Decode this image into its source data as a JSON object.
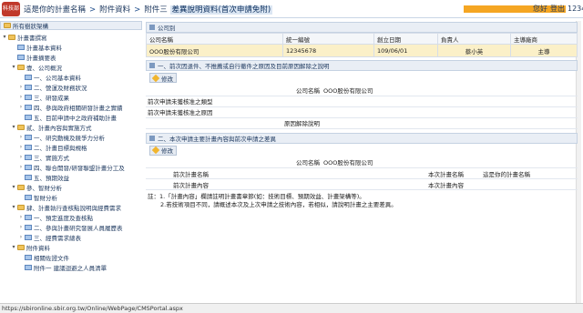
{
  "header": {
    "logo_text": "科技部",
    "breadcrumb": [
      "這是你的計畫名稱",
      "附件資料",
      "附件三"
    ],
    "current_page": "差異說明資料(首次申請免附)",
    "links": [
      "您好",
      "登出",
      "12345"
    ]
  },
  "sidebar": {
    "title": "所有樹狀架構",
    "items": [
      {
        "label": "計畫書撰寫",
        "level": 1,
        "toggle": "▾",
        "icon": "folder"
      },
      {
        "label": "計畫基本資料",
        "level": 2,
        "toggle": "",
        "icon": "doc"
      },
      {
        "label": "計畫摘要表",
        "level": 2,
        "toggle": "",
        "icon": "doc"
      },
      {
        "label": "壹、公司概況",
        "level": 2,
        "toggle": "▾",
        "icon": "folder"
      },
      {
        "label": "一、公司基本資料",
        "level": 3,
        "toggle": "",
        "icon": "doc"
      },
      {
        "label": "二、營運及財務狀況",
        "level": 3,
        "toggle": "›",
        "icon": "doc"
      },
      {
        "label": "三、研發成果",
        "level": 3,
        "toggle": "›",
        "icon": "doc"
      },
      {
        "label": "四、參與政府相關研發計畫之實績",
        "level": 3,
        "toggle": "›",
        "icon": "doc"
      },
      {
        "label": "五、目前申請中之政府補助計畫",
        "level": 3,
        "toggle": "",
        "icon": "doc"
      },
      {
        "label": "貳、計畫內容與實施方式",
        "level": 2,
        "toggle": "▾",
        "icon": "folder"
      },
      {
        "label": "一、研究動機及競爭力分析",
        "level": 3,
        "toggle": "›",
        "icon": "doc"
      },
      {
        "label": "二、計畫目標與規格",
        "level": 3,
        "toggle": "›",
        "icon": "doc"
      },
      {
        "label": "三、實施方式",
        "level": 3,
        "toggle": "›",
        "icon": "doc"
      },
      {
        "label": "四、聯合開發/研發聯盟計畫分工及",
        "level": 3,
        "toggle": "›",
        "icon": "doc"
      },
      {
        "label": "五、預期效益",
        "level": 3,
        "toggle": "",
        "icon": "doc"
      },
      {
        "label": "參、智財分析",
        "level": 2,
        "toggle": "▾",
        "icon": "folder"
      },
      {
        "label": "智財分析",
        "level": 3,
        "toggle": "",
        "icon": "doc"
      },
      {
        "label": "肆、計畫執行查核點說明與經費需求",
        "level": 2,
        "toggle": "▾",
        "icon": "folder"
      },
      {
        "label": "一、預定進度及查核點",
        "level": 3,
        "toggle": "›",
        "icon": "doc"
      },
      {
        "label": "二、參與計畫研究發展人員履歷表",
        "level": 3,
        "toggle": "›",
        "icon": "doc"
      },
      {
        "label": "三、經費需求總表",
        "level": 3,
        "toggle": "›",
        "icon": "doc"
      },
      {
        "label": "附件資料",
        "level": 2,
        "toggle": "▾",
        "icon": "folder"
      },
      {
        "label": "相關佐證文件",
        "level": 3,
        "toggle": "",
        "icon": "doc"
      },
      {
        "label": "附件一  建議迴避之人員清單",
        "level": 3,
        "toggle": "",
        "icon": "doc"
      }
    ]
  },
  "company": {
    "title": "公司別",
    "columns": [
      "公司名稱",
      "統一編號",
      "創立日期",
      "負責人",
      "主導廠商"
    ],
    "rows": [
      [
        "OOO股份有限公司",
        "12345678",
        "109/06/01",
        "蔡小英",
        "主導"
      ]
    ]
  },
  "section1": {
    "title": "一、前次因退件、不推薦或自行撤件之原因及目前原因解除之說明",
    "edit_label": "修改",
    "rows": [
      {
        "label": "公司名稱",
        "value": "OOO股份有限公司"
      },
      {
        "label": "前次申請未獲核准之類型",
        "value": ""
      },
      {
        "label": "前次申請未獲核准之原因",
        "value": ""
      },
      {
        "label": "原因解除說明",
        "value": ""
      }
    ]
  },
  "section2": {
    "title": "二、本次申請主要計畫內容與前次申請之差異",
    "edit_label": "修改",
    "company_label": "公司名稱",
    "company_value": "OOO股份有限公司",
    "prev_name_label": "前次計畫名稱",
    "prev_name_value": "",
    "this_name_label": "本次計畫名稱",
    "this_name_value": "這是你的計畫名稱",
    "prev_content_label": "前次計畫內容",
    "prev_content_value": "",
    "this_content_label": "本次計畫內容",
    "this_content_value": ""
  },
  "notes": [
    "註：1.「計畫內容」欄請註明計畫書章節(如：技術目標、預期效益、計畫架構等)。",
    "2.若技術項目不同，請概述本次及上次申請之技術內容，若相似，請說明計畫之主要差異。"
  ],
  "status": {
    "url": "https://sbironline.sbir.org.tw/Online/WebPage/CMSPortal.aspx"
  },
  "colors": {
    "accent": "#1f3a60",
    "highlight_row": "#fbf0c8",
    "user_bar": "#f5a623"
  }
}
